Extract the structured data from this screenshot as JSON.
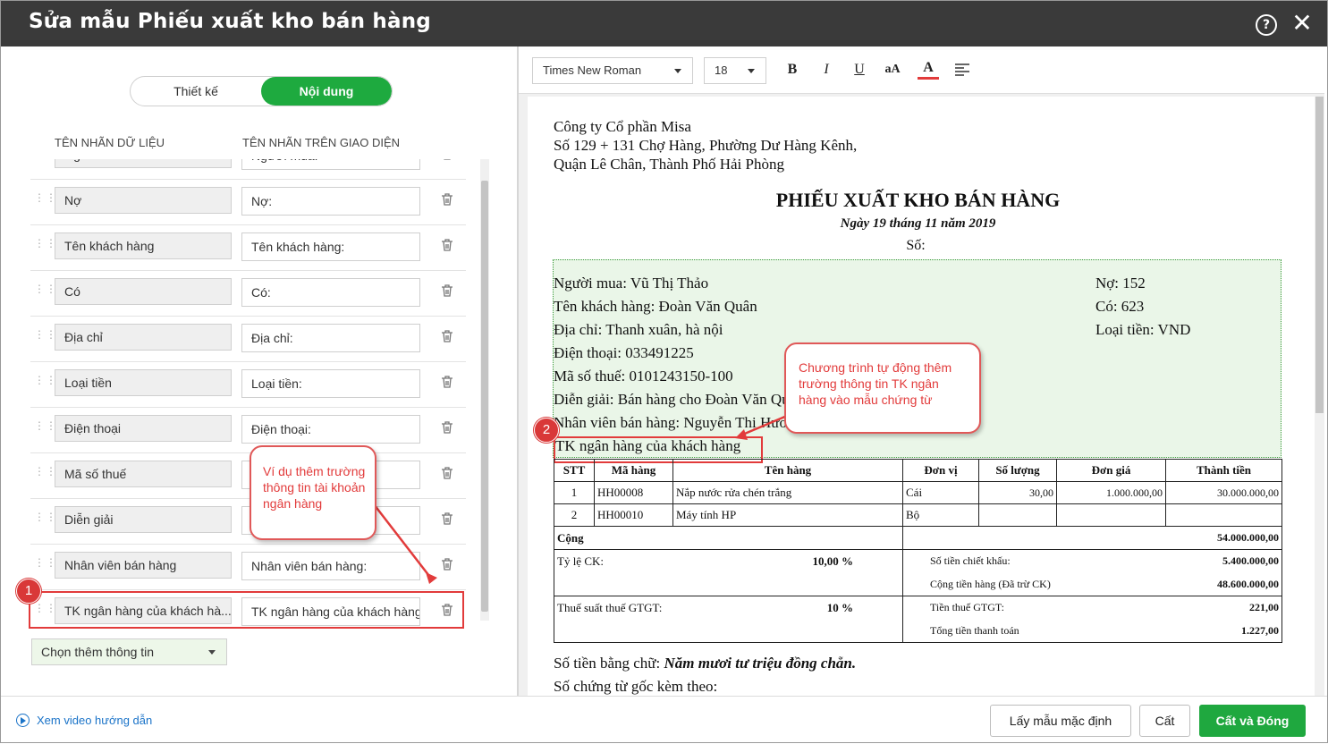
{
  "window": {
    "title": "Sửa mẫu Phiếu xuất kho bán hàng",
    "help": "?",
    "close": "✕"
  },
  "tabs": {
    "design": "Thiết kế",
    "content": "Nội dung"
  },
  "columns": {
    "data_label": "TÊN NHÃN DỮ LIỆU",
    "ui_label": "TÊN NHÃN TRÊN GIAO DIỆN"
  },
  "rows": [
    {
      "data": "Người mua",
      "ui": "Người mua:"
    },
    {
      "data": "Nợ",
      "ui": "Nợ:"
    },
    {
      "data": "Tên khách hàng",
      "ui": "Tên khách hàng:"
    },
    {
      "data": "Có",
      "ui": "Có:"
    },
    {
      "data": "Địa chỉ",
      "ui": "Địa chỉ:"
    },
    {
      "data": "Loại tiền",
      "ui": "Loại tiền:"
    },
    {
      "data": "Điện thoại",
      "ui": "Điện thoại:"
    },
    {
      "data": "Mã số thuế",
      "ui": ""
    },
    {
      "data": "Diễn giải",
      "ui": ""
    },
    {
      "data": "Nhân viên bán hàng",
      "ui": "Nhân viên bán hàng:"
    },
    {
      "data": "TK ngân hàng của khách hà...",
      "ui": "TK ngân hàng của khách hàng"
    }
  ],
  "add_info": "Chọn thêm thông tin",
  "toolbar": {
    "font": "Times New Roman",
    "size": "18",
    "bold": "B",
    "italic": "I",
    "underline": "U",
    "case": "aA",
    "color": "A"
  },
  "doc": {
    "company": "Công ty Cổ phần Misa",
    "address1": "Số 129 + 131 Chợ Hàng, Phường Dư Hàng Kênh,",
    "address2": "Quận Lê Chân, Thành Phố Hải Phòng",
    "title": "PHIẾU XUẤT KHO BÁN HÀNG",
    "date": "Ngày 19 tháng 11 năm 2019",
    "number": "Số:",
    "buyer": "Người mua: Vũ Thị Thảo",
    "customer": "Tên khách hàng: Đoàn Văn Quân",
    "address": "Địa chỉ: Thanh xuân, hà nội",
    "phone": "Điện thoại: 033491225",
    "tax": "Mã số thuế: 0101243150-100",
    "desc": "Diễn giải: Bán hàng cho Đoàn Văn Quân",
    "staff": "Nhân viên bán hàng: Nguyễn Thị Hương",
    "bank": "TK ngân hàng của khách hàng",
    "debit": "Nợ: 152",
    "credit": "Có: 623",
    "currency": "Loại tiền: VND",
    "table_head": [
      "STT",
      "Mã hàng",
      "Tên hàng",
      "Đơn vị",
      "Số lượng",
      "Đơn giá",
      "Thành tiền"
    ],
    "items": [
      [
        "1",
        "HH00008",
        "Nắp nước rửa chén trắng",
        "Cái",
        "30,00",
        "1.000.000,00",
        "30.000.000,00"
      ],
      [
        "2",
        "HH00010",
        "Máy tính HP",
        "Bộ",
        "",
        "",
        ""
      ]
    ],
    "total_label": "Cộng",
    "total_value": "54.000.000,00",
    "discount_rate_label": "Tỷ lệ CK:",
    "discount_rate": "10,00 %",
    "discount_amount_label": "Số tiền chiết khấu:",
    "discount_amount": "5.400.000,00",
    "subtotal_label": "Cộng tiền hàng (Đã trừ CK)",
    "subtotal": "48.600.000,00",
    "vat_rate_label": "Thuế suất thuế GTGT:",
    "vat_rate": "10 %",
    "vat_amount_label": "Tiền thuế GTGT:",
    "vat_amount": "221,00",
    "grand_total_label": "Tổng tiền thanh toán",
    "grand_total": "1.227,00",
    "in_words_label": "Số tiền bằng chữ:",
    "in_words": "Năm mươi tư triệu đồng chẵn.",
    "attachments": "Số chứng từ gốc kèm theo:"
  },
  "callouts": {
    "one_text": "Ví dụ thêm trường thông tin tài khoản ngân hàng",
    "one_badge": "1",
    "two_text": "Chương trình tự động thêm trường thông tin TK ngân hàng vào mẫu chứng từ",
    "two_badge": "2"
  },
  "footer": {
    "video": "Xem video hướng dẫn",
    "default": "Lấy mẫu mặc định",
    "save": "Cất",
    "save_close": "Cất và Đóng"
  },
  "colors": {
    "accent": "#1fa83f",
    "titlebar": "#3a3a3a",
    "annotation": "#e23b3b",
    "link": "#1a73c8"
  }
}
